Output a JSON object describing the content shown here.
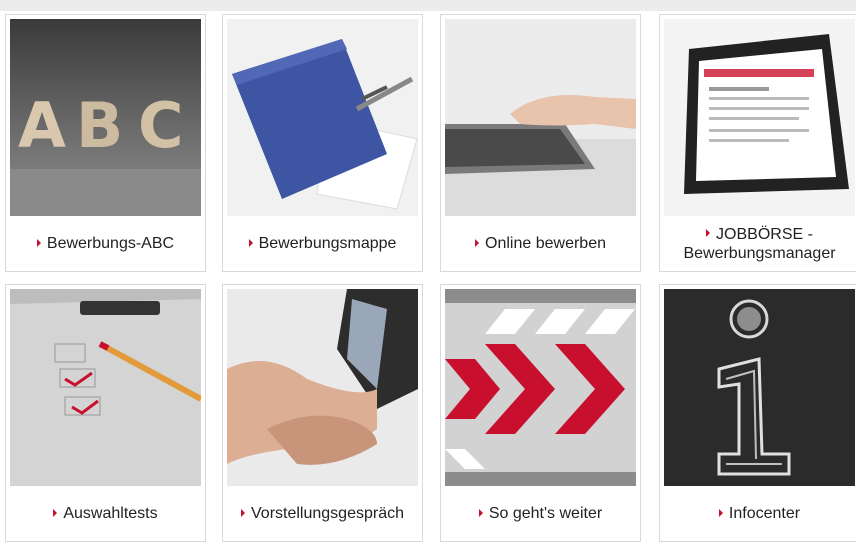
{
  "tiles": [
    {
      "id": "bewerbungs-abc",
      "label": "Bewerbungs-ABC",
      "icon": "abc-letters-image"
    },
    {
      "id": "bewerbungsmappe",
      "label": "Bewerbungsmappe",
      "icon": "folder-pen-image"
    },
    {
      "id": "online-bewerben",
      "label": "Online bewerben",
      "icon": "laptop-typing-image"
    },
    {
      "id": "jobboerse",
      "label_line1": "JOBBÖRSE -",
      "label_line2": "Bewerbungsmanager",
      "icon": "tablet-jobboerse-image"
    },
    {
      "id": "auswahltests",
      "label": "Auswahltests",
      "icon": "clipboard-checklist-image"
    },
    {
      "id": "vorstellungsgespraech",
      "label": "Vorstellungsgespräch",
      "icon": "handshake-image"
    },
    {
      "id": "so-gehts-weiter",
      "label": "So geht's weiter",
      "icon": "red-chevrons-image"
    },
    {
      "id": "infocenter",
      "label": "Infocenter",
      "icon": "chalk-info-image"
    }
  ],
  "colors": {
    "accent": "#c8102e",
    "border": "#d9d9d9",
    "text": "#222222"
  }
}
